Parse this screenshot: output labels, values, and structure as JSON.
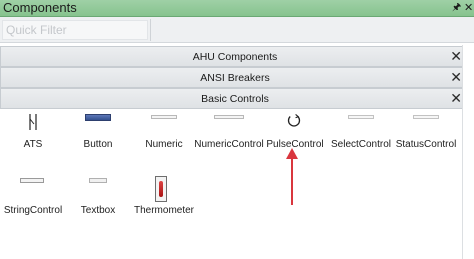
{
  "panel": {
    "title": "Components",
    "pin_icon": "pin-icon",
    "close_icon": "close-icon"
  },
  "filter": {
    "placeholder": "Quick Filter",
    "value": ""
  },
  "groups": [
    {
      "label": "AHU Components",
      "expanded": false
    },
    {
      "label": "ANSI Breakers",
      "expanded": false
    },
    {
      "label": "Basic Controls",
      "expanded": true
    }
  ],
  "basic_controls": [
    {
      "label": "ATS",
      "icon": "ats-icon"
    },
    {
      "label": "Button",
      "icon": "button-icon"
    },
    {
      "label": "Numeric",
      "icon": "numeric-icon"
    },
    {
      "label": "NumericControl",
      "icon": "numeric-control-icon"
    },
    {
      "label": "PulseControl",
      "icon": "pulse-control-icon"
    },
    {
      "label": "SelectControl",
      "icon": "select-control-icon"
    },
    {
      "label": "StatusControl",
      "icon": "status-control-icon"
    },
    {
      "label": "StringControl",
      "icon": "string-control-icon"
    },
    {
      "label": "Textbox",
      "icon": "textbox-icon"
    },
    {
      "label": "Thermometer",
      "icon": "thermometer-icon"
    }
  ],
  "colors": {
    "titlebar": "#86c38e",
    "annotation_arrow": "#d9363e"
  }
}
